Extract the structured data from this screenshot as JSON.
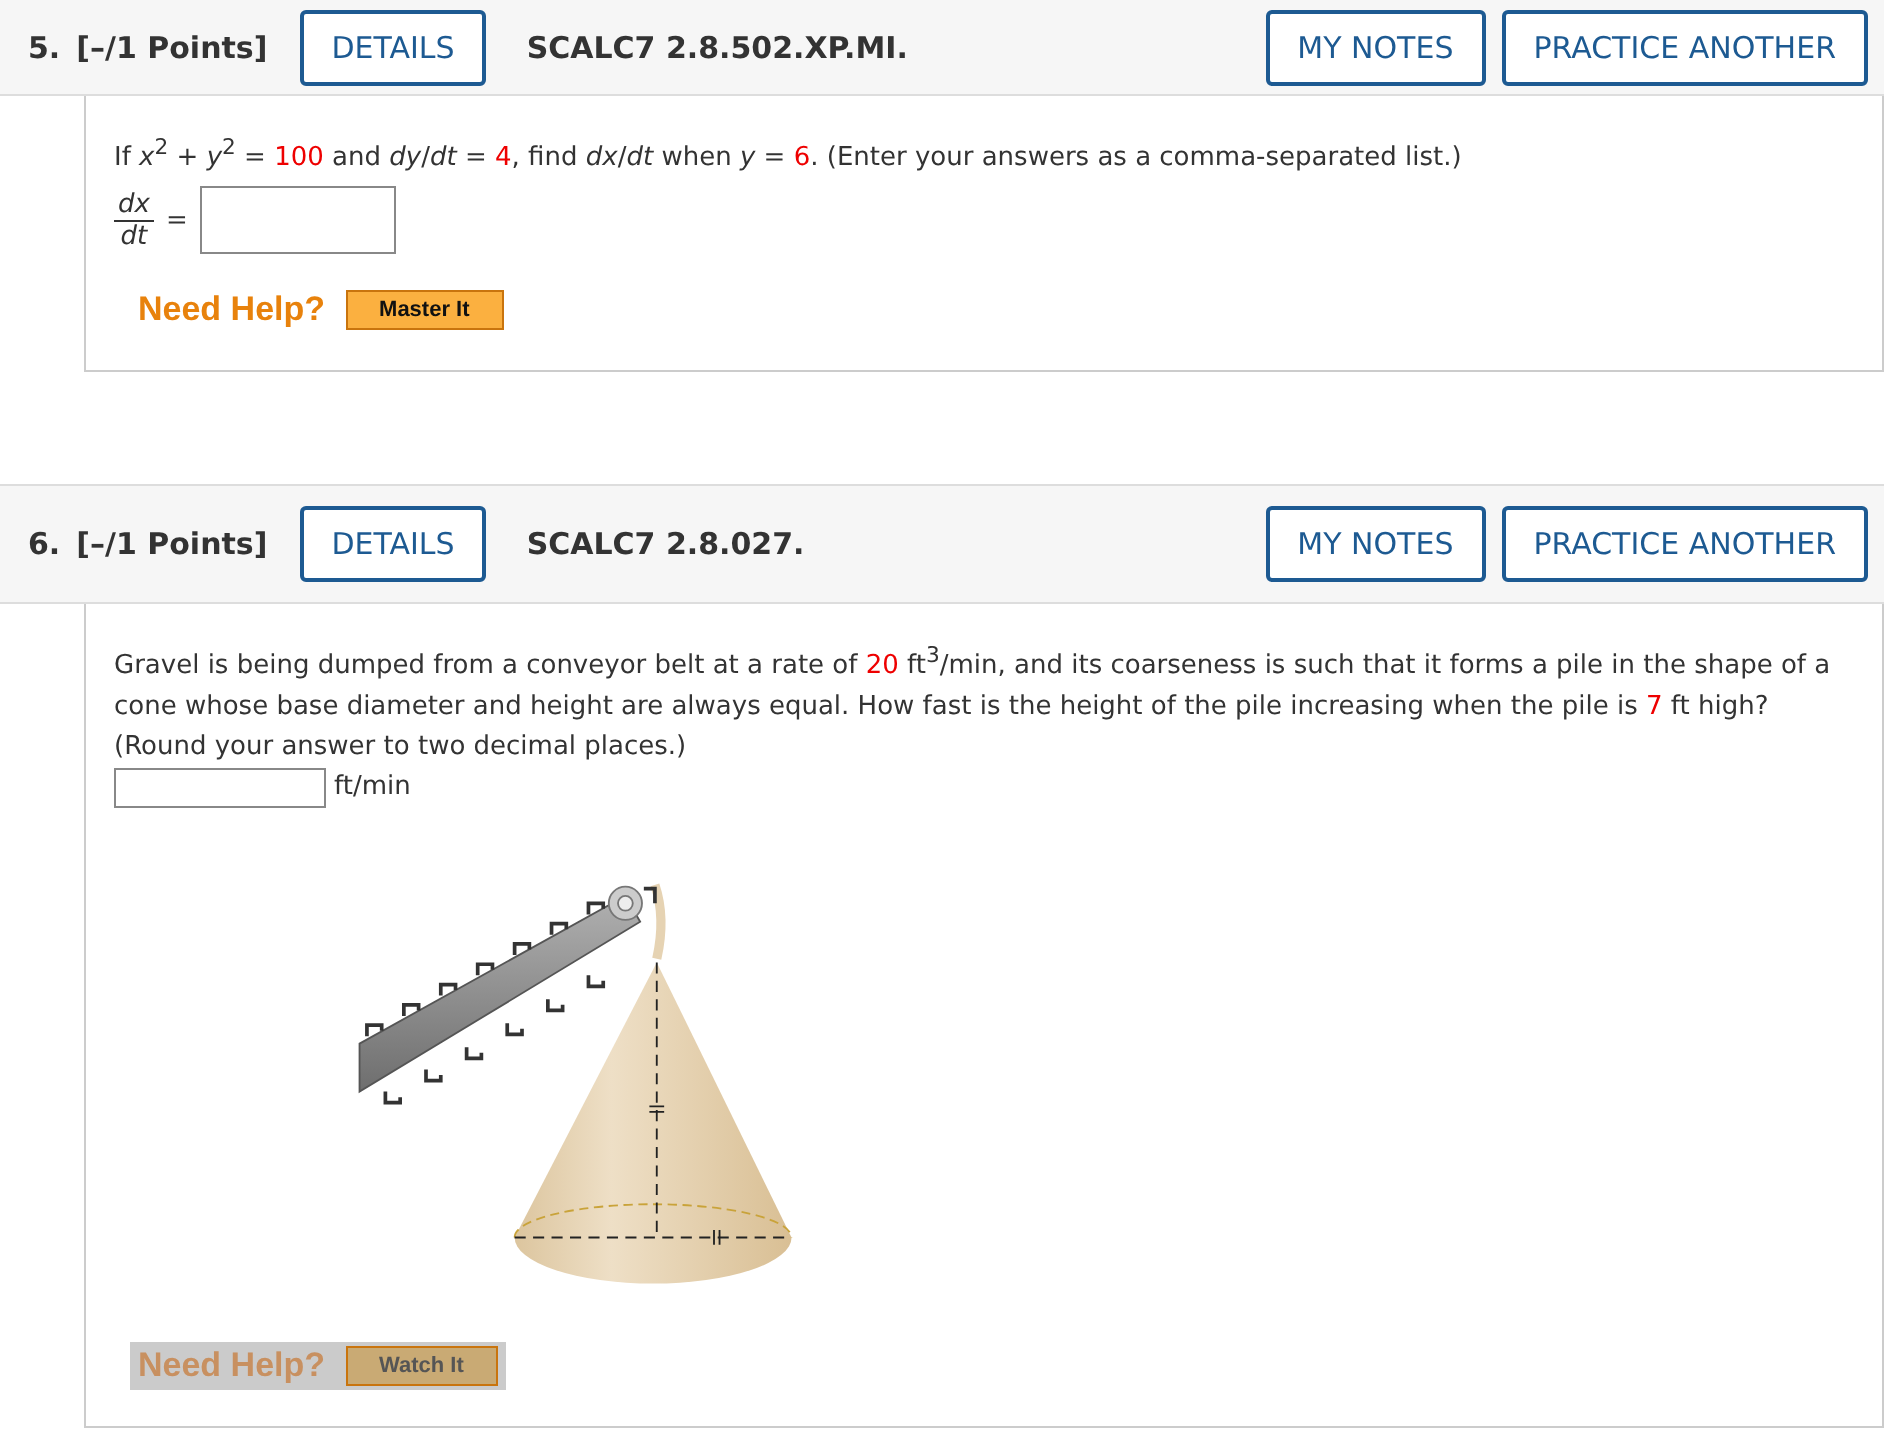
{
  "questions": [
    {
      "number": "5.",
      "points": "[–/1 Points]",
      "details_label": "DETAILS",
      "code": "SCALC7 2.8.502.XP.MI.",
      "notes_label": "MY NOTES",
      "practice_label": "PRACTICE ANOTHER",
      "prompt": [
        {
          "kind": "plain",
          "text": "If *x*$^{2}$ + *y*$^{2}$ = "
        },
        {
          "kind": "given",
          "text": "100"
        },
        {
          "kind": "plain",
          "text": " and *dy*/*dt* = "
        },
        {
          "kind": "given",
          "text": "4"
        },
        {
          "kind": "plain",
          "text": ", find *dx*/*dt* when *y* = "
        },
        {
          "kind": "given",
          "text": "6"
        },
        {
          "kind": "plain",
          "text": ". (Enter your answers as a comma-separated list.)"
        }
      ],
      "answer": {
        "kind": "fraction",
        "numerator": "dx",
        "denominator": "dt",
        "equals": "="
      },
      "figure": false,
      "help": {
        "label": "Need Help?",
        "button": "Master It",
        "highlighted": false
      }
    },
    {
      "number": "6.",
      "points": "[–/1 Points]",
      "details_label": "DETAILS",
      "code": "SCALC7 2.8.027.",
      "notes_label": "MY NOTES",
      "practice_label": "PRACTICE ANOTHER",
      "prompt": [
        {
          "kind": "plain",
          "text": "Gravel is being dumped from a conveyor belt at a rate of "
        },
        {
          "kind": "given",
          "text": "20"
        },
        {
          "kind": "plain",
          "text": " ft$^{3}$/min, and its coarseness is such that it forms a pile in the shape of a cone whose base diameter and height are always equal. How fast is the height of the pile increasing when the pile is "
        },
        {
          "kind": "given",
          "text": "7"
        },
        {
          "kind": "plain",
          "text": " ft high? (Round your answer to two decimal places.)"
        }
      ],
      "answer": {
        "kind": "unit",
        "unit": "ft/min"
      },
      "figure": true,
      "help": {
        "label": "Need Help?",
        "button": "Watch It",
        "highlighted": true
      }
    }
  ]
}
